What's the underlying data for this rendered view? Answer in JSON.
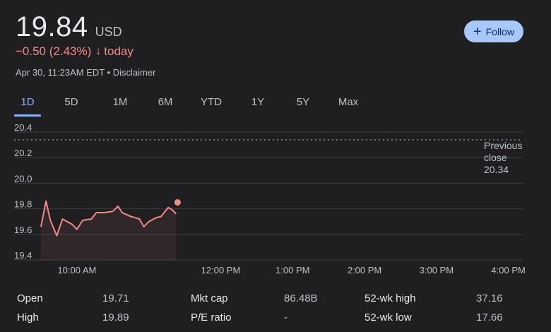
{
  "quote": {
    "price": "19.84",
    "currency": "USD",
    "change": "−0.50 (2.43%)",
    "change_arrow": "↓",
    "change_period": "today",
    "timestamp": "Apr 30, 11:23AM EDT • Disclaimer",
    "follow_label": "Follow",
    "colors": {
      "down": "#f28b82",
      "accent": "#8ab4f8",
      "follow_bg": "#a8c7fa"
    }
  },
  "tabs": [
    {
      "label": "1D",
      "active": true
    },
    {
      "label": "5D",
      "active": false
    },
    {
      "label": "1M",
      "active": false
    },
    {
      "label": "6M",
      "active": false
    },
    {
      "label": "YTD",
      "active": false
    },
    {
      "label": "1Y",
      "active": false
    },
    {
      "label": "5Y",
      "active": false
    },
    {
      "label": "Max",
      "active": false
    }
  ],
  "chart_data": {
    "type": "line",
    "y_ticks": [
      "20.4",
      "20.2",
      "20.0",
      "19.8",
      "19.6",
      "19.4"
    ],
    "ylim": [
      19.4,
      20.4
    ],
    "x_ticks": [
      "10:00 AM",
      "12:00 PM",
      "1:00 PM",
      "2:00 PM",
      "3:00 PM",
      "4:00 PM"
    ],
    "x_tick_hours": [
      10,
      12,
      13,
      14,
      15,
      16
    ],
    "x_range_hours": [
      9.5,
      16.2
    ],
    "previous_close": {
      "label_lines": [
        "Previous",
        "close",
        "20.34"
      ],
      "value": 20.34
    },
    "series": [
      {
        "color": "#f28b82",
        "x_hours": [
          9.5,
          9.57,
          9.63,
          9.72,
          9.8,
          9.93,
          10.0,
          10.08,
          10.2,
          10.27,
          10.38,
          10.5,
          10.57,
          10.63,
          10.75,
          10.87,
          10.93,
          11.0,
          11.1,
          11.17,
          11.27,
          11.33,
          11.38
        ],
        "values": [
          19.66,
          19.86,
          19.71,
          19.59,
          19.72,
          19.68,
          19.64,
          19.71,
          19.72,
          19.77,
          19.77,
          19.78,
          19.82,
          19.77,
          19.74,
          19.72,
          19.66,
          19.7,
          19.73,
          19.74,
          19.81,
          19.79,
          19.76
        ]
      }
    ],
    "last_point": {
      "x_hour": 11.4,
      "value": 19.85
    }
  },
  "stats": [
    {
      "label": "Open",
      "value": "19.71"
    },
    {
      "label": "High",
      "value": "19.89"
    },
    {
      "label": "Mkt cap",
      "value": "86.48B"
    },
    {
      "label": "P/E ratio",
      "value": "-"
    },
    {
      "label": "52-wk high",
      "value": "37.16"
    },
    {
      "label": "52-wk low",
      "value": "17.66"
    }
  ]
}
